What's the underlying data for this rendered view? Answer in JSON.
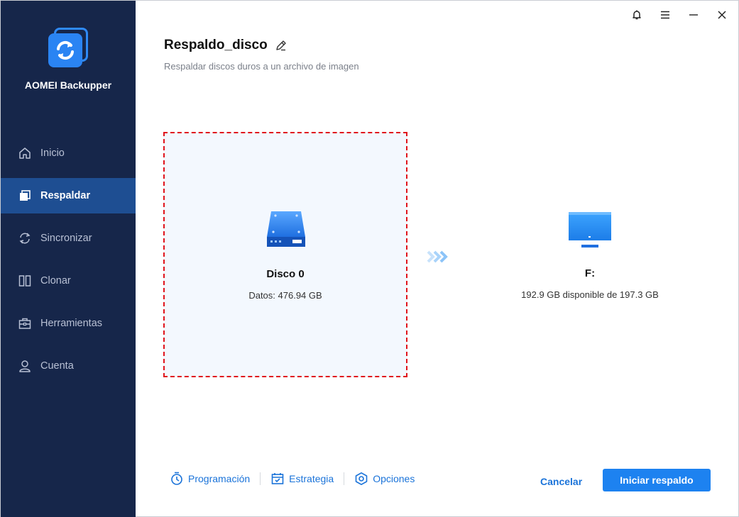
{
  "app": {
    "name": "AOMEI Backupper"
  },
  "sidebar": {
    "items": [
      {
        "label": "Inicio",
        "icon": "home-icon"
      },
      {
        "label": "Respaldar",
        "icon": "backup-icon",
        "active": true
      },
      {
        "label": "Sincronizar",
        "icon": "sync-icon"
      },
      {
        "label": "Clonar",
        "icon": "clone-icon"
      },
      {
        "label": "Herramientas",
        "icon": "toolbox-icon"
      },
      {
        "label": "Cuenta",
        "icon": "user-icon"
      }
    ]
  },
  "titlebar": {
    "icons": [
      "bell-icon",
      "menu-icon",
      "minimize-icon",
      "close-icon"
    ]
  },
  "header": {
    "title": "Respaldo_disco",
    "subtitle": "Respaldar discos duros a un archivo de imagen"
  },
  "source": {
    "name": "Disco 0",
    "info": "Datos: 476.94 GB"
  },
  "destination": {
    "name": "F:",
    "info": "192.9 GB disponible de 197.3 GB"
  },
  "footer": {
    "schedule": "Programación",
    "strategy": "Estrategia",
    "options": "Opciones",
    "cancel": "Cancelar",
    "start": "Iniciar respaldo"
  },
  "colors": {
    "sidebar_bg": "#16264a",
    "sidebar_active": "#1e4e92",
    "accent": "#1d82f0",
    "selection_border": "#e0141c"
  }
}
